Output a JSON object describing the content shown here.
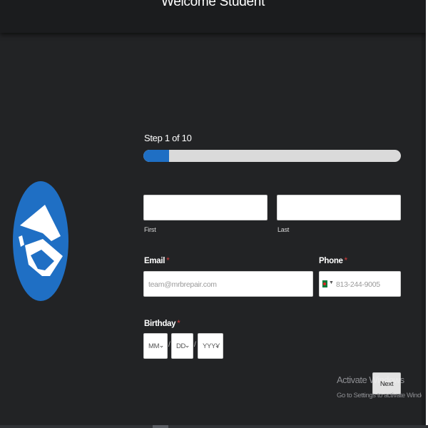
{
  "header": {
    "title": "Welcome Student"
  },
  "colors": {
    "accent": "#1f6fc4",
    "background": "#222325",
    "required": "#d33a3a"
  },
  "logo": {
    "icon": "graduation-cap-icon"
  },
  "progress": {
    "label": "Step 1 of 10",
    "current_step": 1,
    "total_steps": 10,
    "fraction": 0.1
  },
  "name": {
    "first_label": "First",
    "last_label": "Last",
    "first_value": "",
    "last_value": ""
  },
  "email": {
    "label": "Email",
    "required_mark": "*",
    "placeholder": "team@mrbrepair.com"
  },
  "phone": {
    "label": "Phone",
    "required_mark": "*",
    "placeholder": "813-244-9005",
    "flag_icon": "bangladesh-flag-icon"
  },
  "birthday": {
    "label": "Birthday",
    "required_mark": "*",
    "month": "MM",
    "day": "DD",
    "year": "YYYY",
    "separator": "/"
  },
  "actions": {
    "next_label": "Next"
  },
  "watermark": {
    "title": "Activate Windows",
    "subtitle": "Go to Settings to activate Windows."
  }
}
